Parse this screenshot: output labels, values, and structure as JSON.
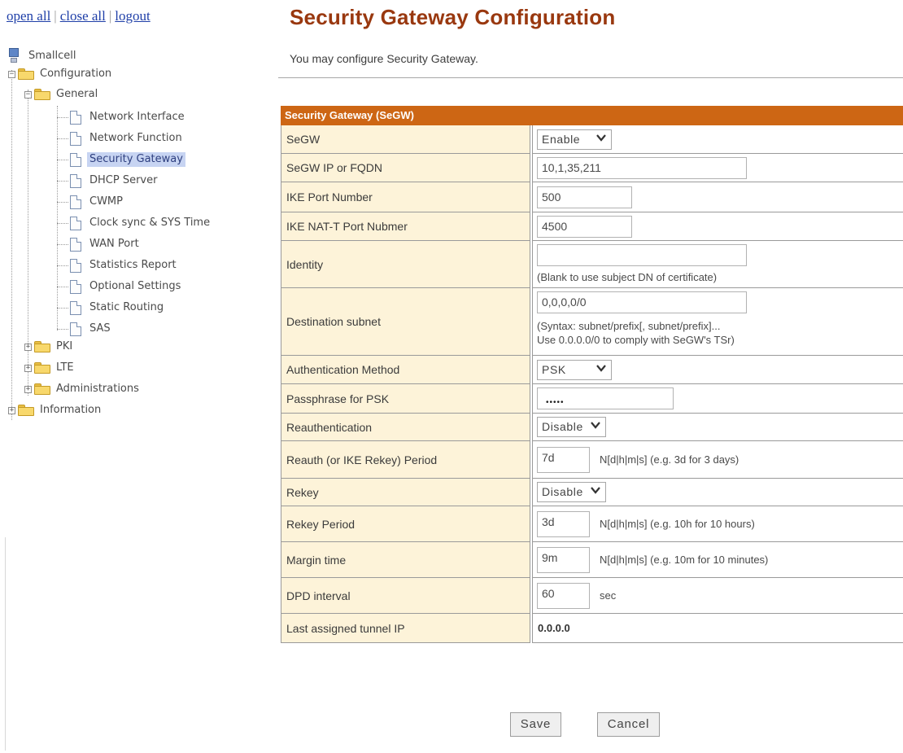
{
  "nav": {
    "links": {
      "open_all": "open all",
      "close_all": "close all",
      "logout": "logout",
      "sep": "|"
    },
    "tree": {
      "root": "Smallcell",
      "configuration": "Configuration",
      "general": "General",
      "general_items": [
        "Network Interface",
        "Network Function",
        "Security Gateway",
        "DHCP Server",
        "CWMP",
        "Clock sync & SYS Time",
        "WAN Port",
        "Statistics Report",
        "Optional Settings",
        "Static Routing",
        "SAS"
      ],
      "pki": "PKI",
      "lte": "LTE",
      "administrations": "Administrations",
      "information": "Information",
      "selected": "Security Gateway"
    }
  },
  "main": {
    "title": "Security Gateway Configuration",
    "description": "You may configure Security Gateway.",
    "section_title": "Security Gateway  (SeGW)",
    "fields": {
      "segw": {
        "label": "SeGW",
        "value": "Enable"
      },
      "segw_ip": {
        "label": "SeGW IP or FQDN",
        "value": "10,1,35,211"
      },
      "ike_port": {
        "label": "IKE Port Number",
        "value": "500"
      },
      "ike_nat_port": {
        "label": "IKE NAT-T Port Nubmer",
        "value": "4500"
      },
      "identity": {
        "label": "Identity",
        "value": "",
        "hint": "(Blank to use subject DN of certificate)"
      },
      "dest_subnet": {
        "label": "Destination subnet",
        "value": "0,0,0,0/0",
        "hint1": "(Syntax: subnet/prefix[, subnet/prefix]...",
        "hint2": "Use 0.0.0.0/0 to comply with SeGW's TSr)"
      },
      "auth_method": {
        "label": "Authentication Method",
        "value": "PSK"
      },
      "passphrase": {
        "label": "Passphrase for PSK",
        "value": "•••••"
      },
      "reauth": {
        "label": "Reauthentication",
        "value": "Disable"
      },
      "reauth_period": {
        "label": "Reauth (or IKE Rekey) Period",
        "value": "7d",
        "unit": "N[d|h|m|s]  (e.g. 3d for 3 days)"
      },
      "rekey": {
        "label": "Rekey",
        "value": "Disable"
      },
      "rekey_period": {
        "label": "Rekey Period",
        "value": "3d",
        "unit": "N[d|h|m|s]  (e.g. 10h for 10 hours)"
      },
      "margin_time": {
        "label": "Margin time",
        "value": "9m",
        "unit": "N[d|h|m|s]  (e.g. 10m for 10 minutes)"
      },
      "dpd": {
        "label": "DPD interval",
        "value": "60",
        "unit": "sec"
      },
      "tunnel_ip": {
        "label": "Last assigned tunnel IP",
        "value": "0.0.0.0"
      }
    },
    "buttons": {
      "save": "Save",
      "cancel": "Cancel"
    }
  },
  "colors": {
    "title": "#99380f",
    "section_header": "#cd6614",
    "label_bg": "#fdf3d9",
    "link": "#1f3fa8",
    "selection": "#c7d4f2"
  }
}
